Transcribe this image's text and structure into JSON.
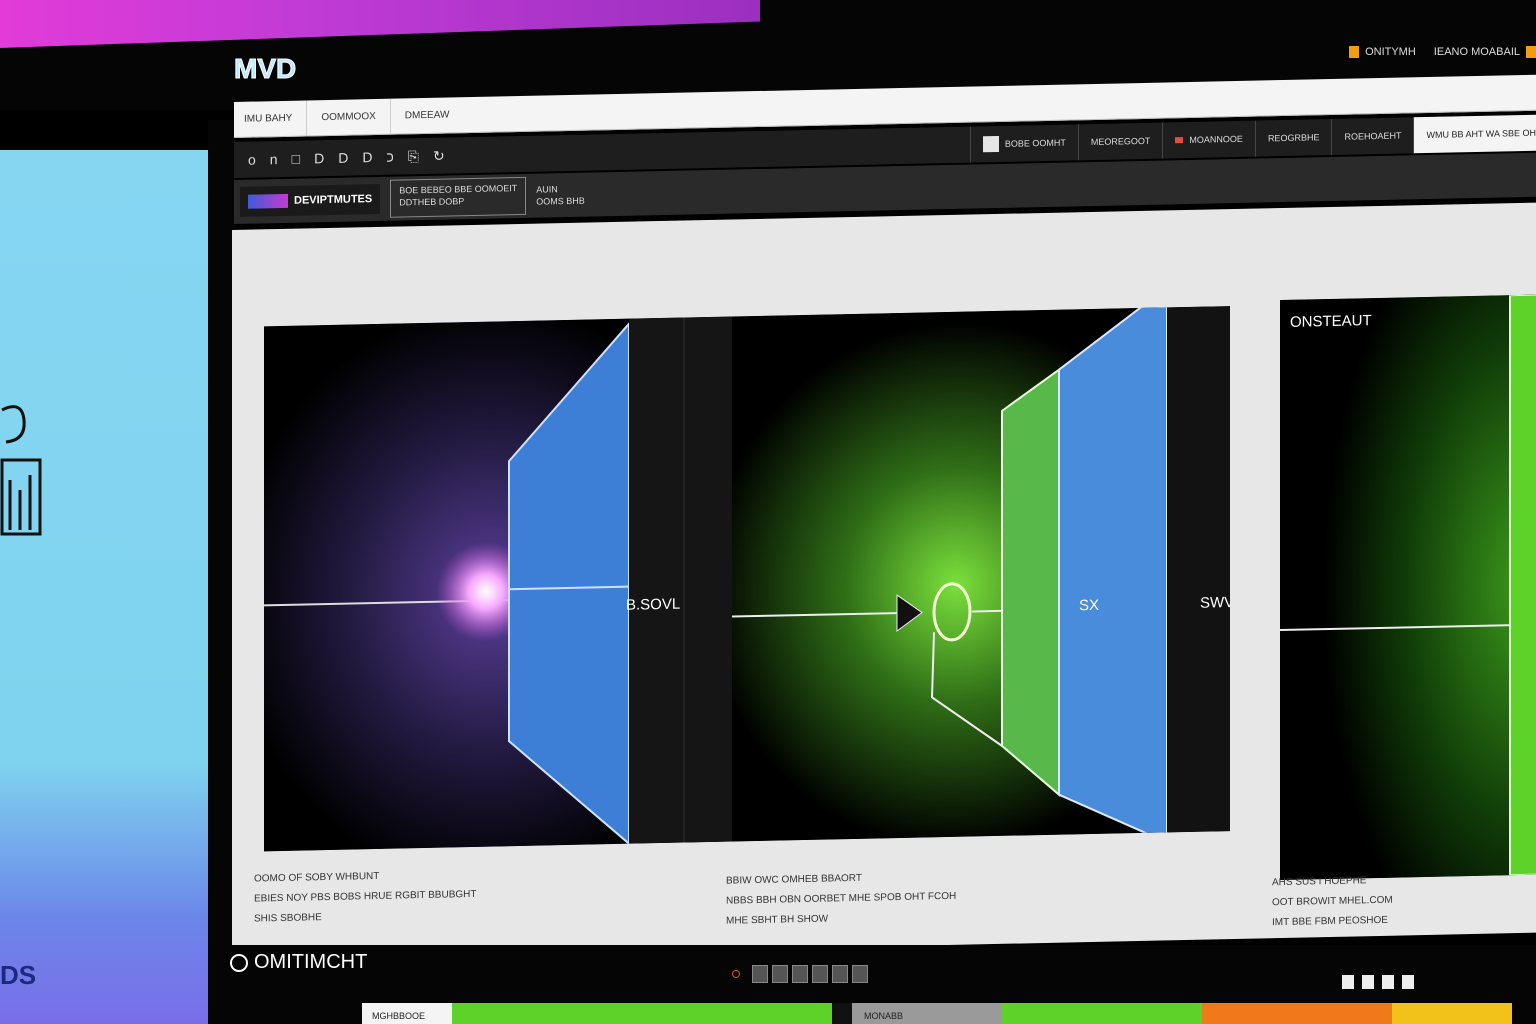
{
  "app": {
    "logo_text": "MVD"
  },
  "header_right": {
    "item1": "ONITYMH",
    "item2": "IEANO MOABAIL"
  },
  "tabs": [
    "IMU BAHY",
    "OOMMOOX",
    "DMEEAW"
  ],
  "toolbar": {
    "icons": [
      "o-icon",
      "n-icon",
      "square-icon",
      "d-icon",
      "d-icon",
      "d-icon",
      "hook-icon",
      "export-icon",
      "refresh-icon"
    ],
    "right_buttons": [
      "BOBE OOMHT",
      "MEOREGOOT",
      "MOANNOOE",
      "REOGRBHE",
      "ROEHOAEHT",
      "WMU BB AHT WA SBE OHE"
    ]
  },
  "subbar": {
    "brand": "DEVIPTMUTES",
    "panel_line1": "BOE BEBEO BBE OOMOEIT",
    "panel_line2": "DDTHEB DOBP",
    "panel2_line1": "AUIN",
    "panel2_line2": "OOMS BHB"
  },
  "frames": [
    {
      "label": "B.SOVL",
      "accent": "#c24fd6",
      "panel": "#3d7fd6"
    },
    {
      "label": "SX",
      "accent": "#5fd22a",
      "panel": "#4a8cdc"
    },
    {
      "label": "ONSTEAUT",
      "accent": "#5fd22a",
      "panel": "#5fd22a"
    }
  ],
  "frame_side_label": "SWV",
  "captions": [
    [
      "OOMO OF SOBY WHBUNT",
      "EBIES NOY PBS BOBS HRUE RGBIT BBUBGHT",
      "SHIS SBOBHE"
    ],
    [
      "BBIW OWC OMHEB BBAORT",
      "NBBS BBH OBN OORBET MHE SPOB OHT FCOH",
      "MHE SBHT BH SHOW"
    ],
    [
      "AHS SUS I HOEPHE",
      "OOT BROWIT MHEL.COM",
      "IMT BBE FBM PEOSHOE"
    ]
  ],
  "bottom": {
    "title": "OMITIMCHT",
    "tile_label1": "MGHBBOOE",
    "tile_label2": "MONABB"
  },
  "wall": {
    "bottom_text": "DS"
  }
}
